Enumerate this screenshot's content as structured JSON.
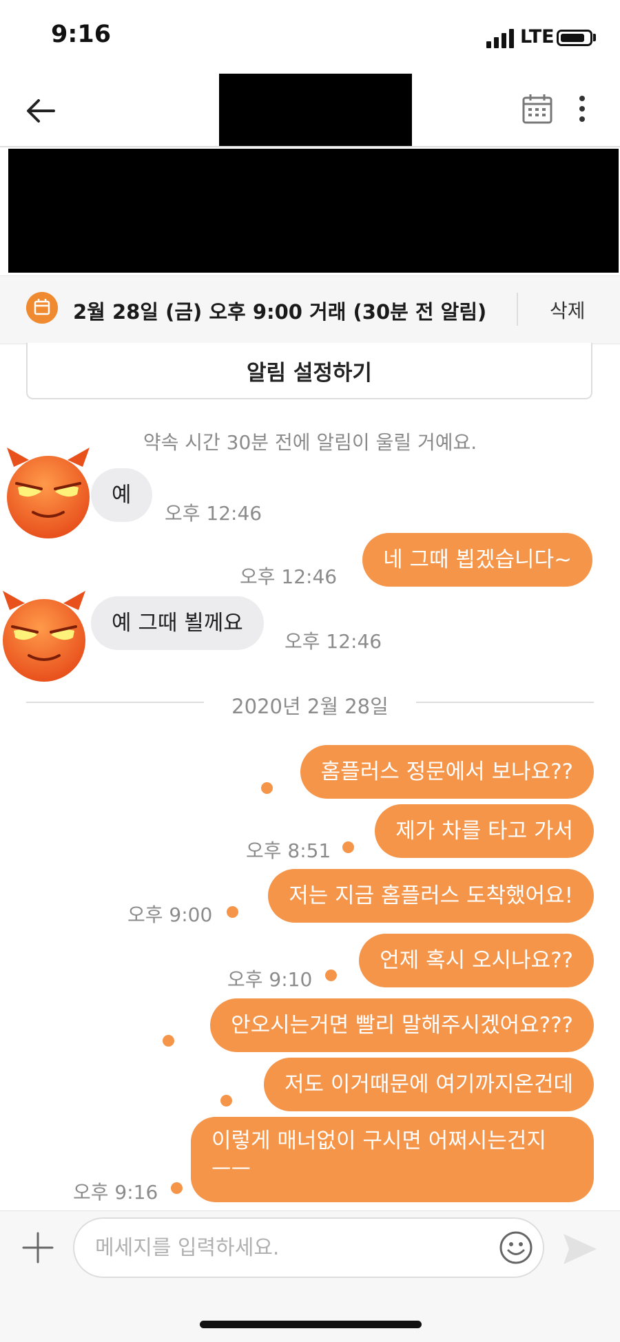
{
  "status_bar": {
    "time": "9:16",
    "network": "LTE"
  },
  "header": {
    "back_icon": "back-arrow-icon",
    "calendar_icon": "calendar-icon",
    "more_icon": "more-vertical-icon"
  },
  "appointment": {
    "icon": "calendar-icon",
    "text": "2월 28일 (금) 오후 9:00 거래 (30분 전 알림)",
    "delete_label": "삭제"
  },
  "alarm_button": {
    "label": "알림 설정하기"
  },
  "system_message": "약속 시간 30분 전에 알림이 울릴 거예요.",
  "date_separator": "2020년 2월 28일",
  "messages": [
    {
      "side": "in",
      "text": "예",
      "time": "오후 12:46"
    },
    {
      "side": "out",
      "text": "네 그때 뵙겠습니다~",
      "time": "오후 12:46"
    },
    {
      "side": "in",
      "text": "예 그때 뵐께요",
      "time": "오후 12:46"
    },
    {
      "side": "out",
      "text": "홈플러스 정문에서 보나요??",
      "time": ""
    },
    {
      "side": "out",
      "text": "제가 차를 타고 가서",
      "time": "오후 8:51"
    },
    {
      "side": "out",
      "text": "저는 지금 홈플러스 도착했어요!",
      "time": "오후 9:00"
    },
    {
      "side": "out",
      "text": "언제 혹시 오시나요??",
      "time": "오후 9:10"
    },
    {
      "side": "out",
      "text": "안오시는거면 빨리 말해주시겠어요???",
      "time": ""
    },
    {
      "side": "out",
      "text": "저도 이거때문에 여기까지온건데",
      "time": ""
    },
    {
      "side": "out",
      "text": "이렇게 매너없이 구시면 어쩌시는건지",
      "text_line2": "ㅡㅡ",
      "time": "오후 9:16"
    }
  ],
  "input": {
    "placeholder": "메세지를 입력하세요.",
    "value": ""
  },
  "colors": {
    "accent": "#f5954a",
    "incoming_bubble": "#ececee",
    "appointment_icon": "#f08a30"
  }
}
